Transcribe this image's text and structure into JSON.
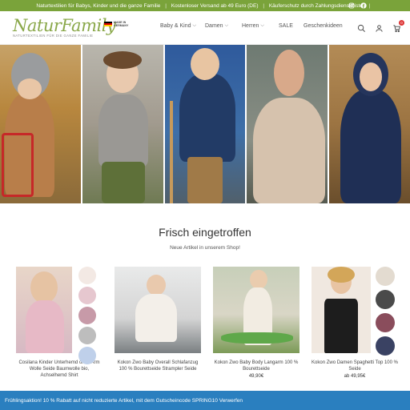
{
  "topbar": {
    "msg1": "Naturtextilien für Babys, Kinder und die ganze Familie",
    "msg2": "Kostenloser Versand ab 49 Euro (DE)",
    "msg3": "Käuferschutz durch Zahlungsdienstleister",
    "sep": "|",
    "color": "#7aa33a"
  },
  "header": {
    "logo_word": "NaturFamily",
    "logo_sub": "NATURTEXTILIEN FÜR DIE GANZE FAMILIE",
    "made_line1": "MADE IN",
    "made_line2": "GERMANY",
    "cart_count": "0"
  },
  "nav": {
    "items": [
      {
        "label": "Baby & Kind",
        "chev": "⌵"
      },
      {
        "label": "Damen",
        "chev": "⌵"
      },
      {
        "label": "Herren",
        "chev": "⌵"
      },
      {
        "label": "SALE",
        "chev": ""
      },
      {
        "label": "Geschenkideen",
        "chev": ""
      }
    ]
  },
  "section": {
    "title": "Frisch eingetroffen",
    "subtitle": "Neue Artikel in unserem Shop!"
  },
  "products": [
    {
      "title": "Cosilana Kinder Unterhemd ohne Arm Wolle Seide Baumwolle bio, Achselhemd Shirt",
      "price": "",
      "swatches": [
        "#f3e9e4",
        "#e6c7cf",
        "#c79aa8",
        "#bdbdbd",
        "#bfd0ea"
      ]
    },
    {
      "title": "Kokon Zwo Baby Overall Schlafanzug 100 % Bourettseide Strampler Seide",
      "price": "",
      "swatches": []
    },
    {
      "title": "Kokon Zwo Baby Body Langarm 100 % Bourettseide",
      "price": "49,90€",
      "swatches": []
    },
    {
      "title": "Kokon Zwo Damen Spaghetti Top 100 % Seide",
      "price": "ab 49,95€",
      "swatches": [
        "#e3dbd0",
        "#4a4a4a",
        "#8a4d5c",
        "#3a4263"
      ]
    }
  ],
  "promo": {
    "text": "Frühlingsaktion! 10 % Rabatt auf nicht reduzierte Artikel, mit dem Gutscheincode SPRING10 Verwerfen",
    "color": "#2a7fbf"
  }
}
